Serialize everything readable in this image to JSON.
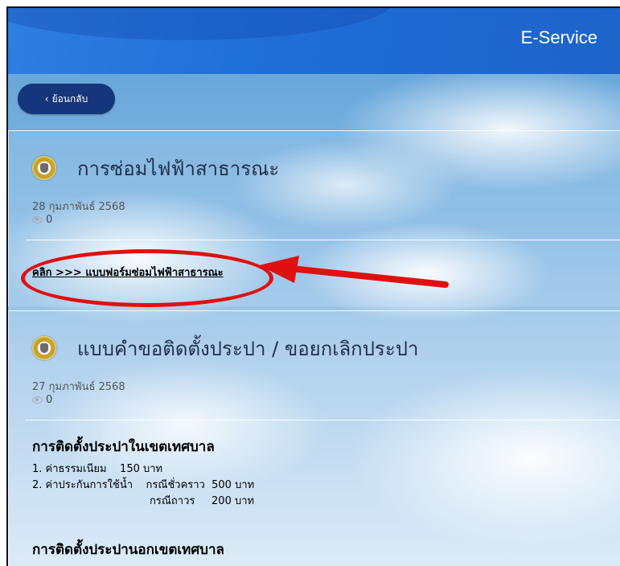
{
  "header": {
    "title": "E-Service"
  },
  "back_button": {
    "label": "ย้อนกลับ"
  },
  "posts": [
    {
      "title": "การซ่อมไฟฟ้าสาธารณะ",
      "date": "28 กุมภาพันธ์ 2568",
      "views": "0",
      "link": "คลิก >>> แบบฟอร์มซ่อมไฟฟ้าสาธารณะ"
    },
    {
      "title": "แบบคำขอติดตั้งประปา / ขอยกเลิกประปา",
      "date": "27 กุมภาพันธ์ 2568",
      "views": "0",
      "section1_heading": "การติดตั้งประปาในเขตเทศบาล",
      "section1_lines": [
        "1. ค่าธรรมเนียม    150 บาท",
        "2. ค่าประกันการใช้น้ำ    กรณีชั่วคราว  500 บาท",
        "กรณีถาวร     200 บาท"
      ],
      "section2_heading": "การติดตั้งประปานอกเขตเทศบาล"
    }
  ],
  "annotation_colors": {
    "highlight": "#e01010"
  }
}
